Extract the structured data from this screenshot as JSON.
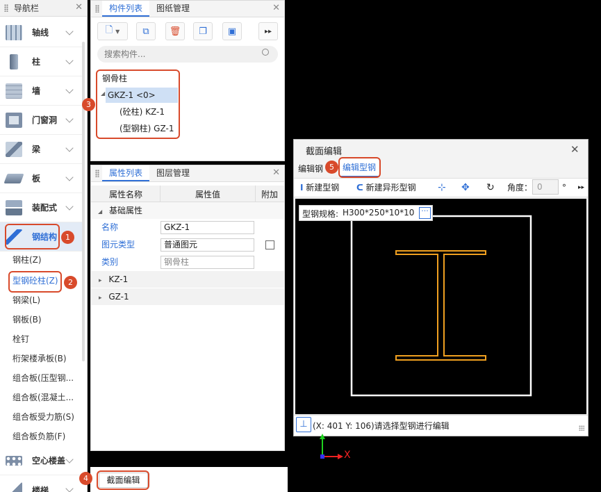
{
  "nav": {
    "title": "导航栏",
    "categories": [
      {
        "label": "轴线",
        "icon": "grid-axis-icon"
      },
      {
        "label": "柱",
        "icon": "column-icon"
      },
      {
        "label": "墙",
        "icon": "wall-icon"
      },
      {
        "label": "门窗洞",
        "icon": "door-window-icon"
      },
      {
        "label": "梁",
        "icon": "beam-icon"
      },
      {
        "label": "板",
        "icon": "slab-icon"
      },
      {
        "label": "装配式",
        "icon": "prefab-icon"
      },
      {
        "label": "钢结构",
        "icon": "steel-structure-icon"
      }
    ],
    "steel_items": [
      "钢柱(Z)",
      "型钢砼柱(Z)",
      "钢梁(L)",
      "钢板(B)",
      "栓钉",
      "桁架楼承板(B)",
      "组合板(压型钢...",
      "组合板(混凝土...",
      "组合板受力筋(S)",
      "组合板负筋(F)"
    ],
    "bottom_categories": [
      {
        "label": "空心楼盖",
        "icon": "hollow-floor-icon"
      },
      {
        "label": "楼梯",
        "icon": "stair-icon"
      }
    ]
  },
  "components": {
    "tabs": [
      "构件列表",
      "图纸管理"
    ],
    "search_placeholder": "搜索构件...",
    "tree": {
      "group": "钢骨柱",
      "selected": "GKZ-1 <0>",
      "children": [
        "(砼柱) KZ-1",
        "(型钢柱) GZ-1"
      ]
    }
  },
  "props": {
    "tabs": [
      "属性列表",
      "图层管理"
    ],
    "headers": [
      "属性名称",
      "属性值",
      "附加"
    ],
    "group": "基础属性",
    "rows": [
      {
        "name": "名称",
        "value": "GKZ-1"
      },
      {
        "name": "图元类型",
        "value": "普通图元"
      },
      {
        "name": "类别",
        "value": "钢骨柱"
      }
    ],
    "collapsed": [
      "KZ-1",
      "GZ-1"
    ]
  },
  "bottom_tab": "截面编辑",
  "dialog": {
    "title": "截面编辑",
    "tabs": [
      "编辑钢",
      "编辑型钢"
    ],
    "tools": {
      "new_steel": "新建型钢",
      "new_irregular": "新建异形型钢",
      "angle_label": "角度：",
      "angle_value": "0",
      "degree": "°"
    },
    "spec_label": "型钢规格:",
    "spec_value": "H300*250*10*10",
    "status": "(X: 401 Y: 106)请选择型钢进行编辑",
    "axis_x": "X"
  },
  "badges": [
    "1",
    "2",
    "3",
    "4",
    "5"
  ],
  "colors": {
    "accent": "#2f6fd6",
    "highlight": "#d84a2b",
    "section": "#f0a020"
  }
}
